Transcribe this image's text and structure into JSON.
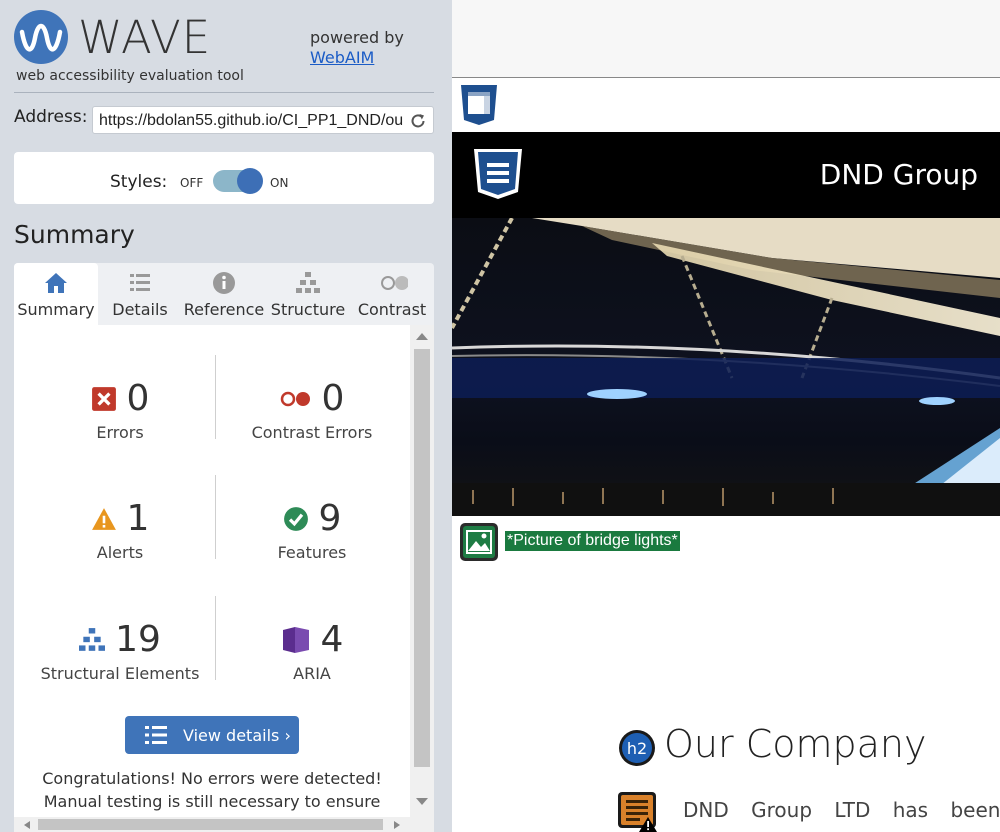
{
  "wave": {
    "logo_word": "WAVE",
    "tagline": "web accessibility evaluation tool",
    "powered_by": "powered by",
    "powered_link": "WebAIM",
    "address_label": "Address:",
    "address_value": "https://bdolan55.github.io/CI_PP1_DND/ou",
    "styles_label": "Styles:",
    "styles_off": "OFF",
    "styles_on": "ON",
    "styles_state": "on",
    "summary_heading": "Summary",
    "tabs": [
      {
        "label": "Summary",
        "icon": "home-icon",
        "active": true
      },
      {
        "label": "Details",
        "icon": "list-icon",
        "active": false
      },
      {
        "label": "Reference",
        "icon": "info-icon",
        "active": false
      },
      {
        "label": "Structure",
        "icon": "hierarchy-icon",
        "active": false
      },
      {
        "label": "Contrast",
        "icon": "contrast-icon",
        "active": false
      }
    ],
    "stats": [
      {
        "label": "Errors",
        "value": "0",
        "icon": "error-x-icon",
        "color": "#c0392b"
      },
      {
        "label": "Contrast Errors",
        "value": "0",
        "icon": "contrast-error-icon",
        "color": "#c0392b"
      },
      {
        "label": "Alerts",
        "value": "1",
        "icon": "alert-triangle-icon",
        "color": "#e8961e"
      },
      {
        "label": "Features",
        "value": "9",
        "icon": "feature-check-icon",
        "color": "#2e8b57"
      },
      {
        "label": "Structural Elements",
        "value": "19",
        "icon": "structure-icon",
        "color": "#3f74b9"
      },
      {
        "label": "ARIA",
        "value": "4",
        "icon": "aria-icon",
        "color": "#5b2d8e"
      }
    ],
    "view_details": "View details ›",
    "congrats_line1": "Congratulations! No errors were detected!",
    "congrats_line2": "Manual testing is still necessary to ensure"
  },
  "preview": {
    "brand": "DND Group",
    "image_alt": "*Picture of bridge lights*",
    "heading_badge": "h2",
    "heading": "Our Company",
    "paragraph": "DND Group LTD has been e"
  },
  "colors": {
    "accent": "#3f74b9",
    "sidebar_bg": "#d7dce3",
    "alt_text_bg": "#1a7a3f"
  }
}
